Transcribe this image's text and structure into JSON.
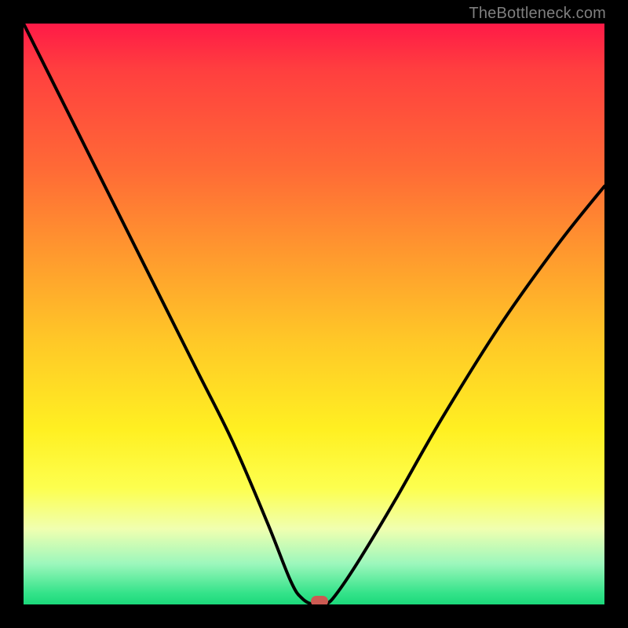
{
  "attribution": "TheBottleneck.com",
  "colors": {
    "top": "#ff1a47",
    "bottom": "#1bd97b",
    "curve": "#000000",
    "marker": "#cc5a52",
    "frame": "#000000",
    "attribution_text": "#7f7f7f"
  },
  "chart_data": {
    "type": "line",
    "title": "",
    "xlabel": "",
    "ylabel": "",
    "xlim": [
      0,
      100
    ],
    "ylim": [
      0,
      100
    ],
    "grid": false,
    "legend": false,
    "series": [
      {
        "name": "bottleneck-curve",
        "x": [
          0,
          6,
          12,
          18,
          24,
          30,
          36,
          42,
          46,
          48,
          50,
          52,
          54,
          58,
          64,
          72,
          82,
          92,
          100
        ],
        "values": [
          100,
          88,
          76,
          64,
          52,
          40,
          28,
          14,
          4,
          1,
          0,
          0,
          2,
          8,
          18,
          32,
          48,
          62,
          72
        ]
      }
    ],
    "marker": {
      "x": 51,
      "y": 0
    },
    "gradient_stops": [
      {
        "pos": 0,
        "color": "#ff1a47"
      },
      {
        "pos": 8,
        "color": "#ff3f3f"
      },
      {
        "pos": 25,
        "color": "#ff6a36"
      },
      {
        "pos": 40,
        "color": "#ff9a2e"
      },
      {
        "pos": 55,
        "color": "#ffc927"
      },
      {
        "pos": 70,
        "color": "#fff022"
      },
      {
        "pos": 80,
        "color": "#fdff4f"
      },
      {
        "pos": 87,
        "color": "#f0ffb0"
      },
      {
        "pos": 93,
        "color": "#9cf7bc"
      },
      {
        "pos": 98,
        "color": "#35e38a"
      },
      {
        "pos": 100,
        "color": "#1bd97b"
      }
    ]
  }
}
